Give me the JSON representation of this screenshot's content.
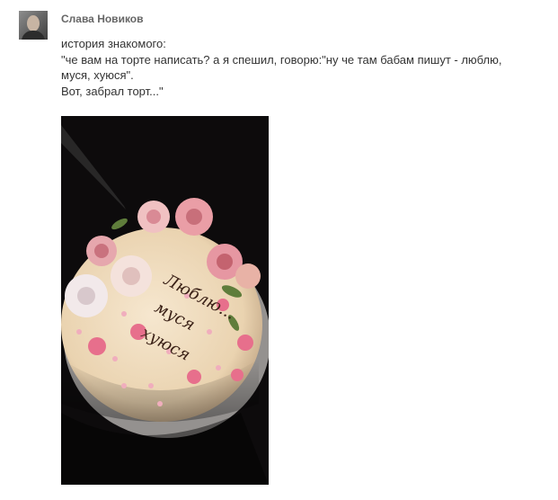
{
  "post": {
    "author_name": "Слава Новиков",
    "avatar_icon": "user-avatar",
    "lines": [
      "история знакомого:",
      "\"че вам на торте написать? а я спешил, говорю:\"ну че там бабам пишут - люблю,",
      "муся, хуюся\".",
      "Вот, забрал торт...\""
    ],
    "photo": {
      "cake_inscription": [
        "Люблю...",
        "муся",
        "хуюся"
      ]
    }
  },
  "colors": {
    "author": "#666666",
    "text": "#333333",
    "photo_background": "#0d0b0c",
    "cake_base": "#f2e2c8",
    "roses": "#e9a0a8",
    "berries": "#e76f8c"
  }
}
